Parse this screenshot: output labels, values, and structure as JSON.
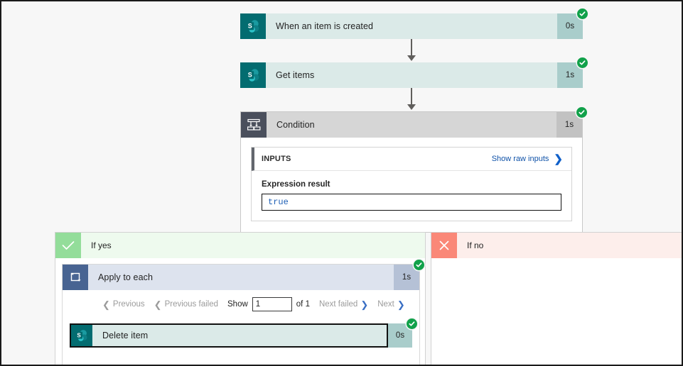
{
  "flow": {
    "trigger": {
      "title": "When an item is created",
      "duration": "0s",
      "icon": "sharepoint-icon",
      "status": "succeeded-icon"
    },
    "get_items": {
      "title": "Get items",
      "duration": "1s",
      "icon": "sharepoint-icon",
      "status": "succeeded-icon"
    },
    "condition": {
      "title": "Condition",
      "duration": "1s",
      "icon": "condition-icon",
      "status": "succeeded-icon",
      "inputs": {
        "section_label": "INPUTS",
        "raw_link": "Show raw inputs",
        "expression_label": "Expression result",
        "expression_value": "true"
      }
    },
    "branch_yes": {
      "label": "If yes",
      "mark": "check-icon"
    },
    "branch_no": {
      "label": "If no",
      "mark": "cross-icon"
    },
    "apply_to_each": {
      "title": "Apply to each",
      "duration": "1s",
      "icon": "loop-icon",
      "status": "succeeded-icon",
      "pager": {
        "previous": "Previous",
        "previous_failed": "Previous failed",
        "show": "Show",
        "page_value": "1",
        "page_placeholder": "1",
        "of": "of 1",
        "next_failed": "Next failed",
        "next": "Next"
      }
    },
    "delete_item": {
      "title": "Delete item",
      "duration": "0s",
      "icon": "sharepoint-icon",
      "status": "succeeded-icon"
    }
  },
  "colors": {
    "sharepoint_teal": "#036c70",
    "card_body": "#dbeae8",
    "card_duration": "#a9cdcb",
    "condition_icon_bg": "#4a4f5c",
    "loop_icon_bg": "#486492",
    "success_green": "#11a14a",
    "yes_green": "#93dd9a",
    "no_red": "#fa8878",
    "link_blue": "#0f52a8",
    "expression_blue": "#1e5fb5",
    "connector_grey": "#605e5c"
  }
}
